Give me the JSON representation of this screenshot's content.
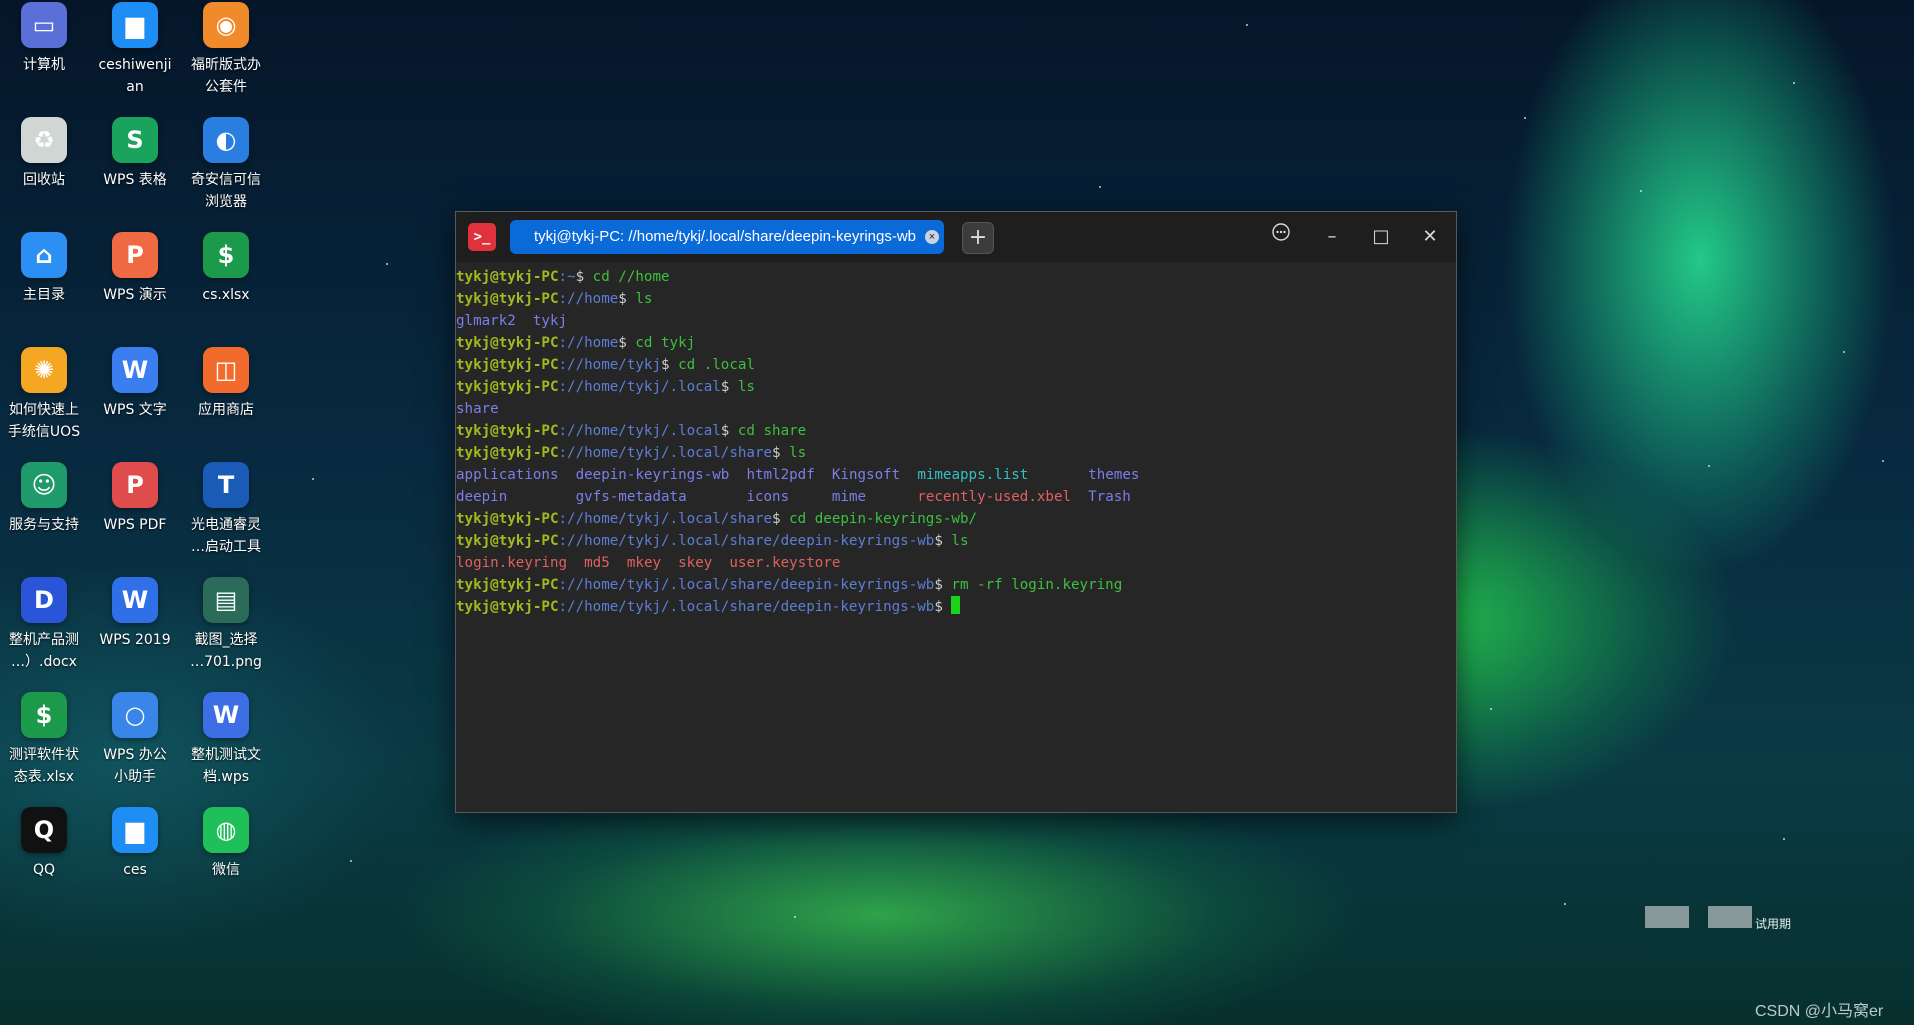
{
  "desktop": {
    "icons": [
      {
        "label": "计算机",
        "icon": "computer-icon",
        "color": "#5a6fd8"
      },
      {
        "label": "ceshiwenji\nan",
        "icon": "folder-icon",
        "color": "#1e8ef5"
      },
      {
        "label": "福昕版式办\n公套件",
        "icon": "ofd-icon",
        "color": "#f08a2a"
      },
      {
        "label": "回收站",
        "icon": "trash-icon",
        "color": "#cfd6d3"
      },
      {
        "label": "WPS 表格",
        "icon": "wps-spreadsheet-icon",
        "color": "#1aa35c"
      },
      {
        "label": "奇安信可信\n浏览器",
        "icon": "browser-icon",
        "color": "#2a7ee0"
      },
      {
        "label": "主目录",
        "icon": "home-folder-icon",
        "color": "#2c8ff3"
      },
      {
        "label": "WPS 演示",
        "icon": "wps-presentation-icon",
        "color": "#ef6a42"
      },
      {
        "label": "cs.xlsx",
        "icon": "xlsx-file-icon",
        "color": "#1c9a4c"
      },
      {
        "label": "如何快速上\n手统信UOS",
        "icon": "uos-guide-icon",
        "color": "#f5a623"
      },
      {
        "label": "WPS 文字",
        "icon": "wps-writer-icon",
        "color": "#3a7ef0"
      },
      {
        "label": "应用商店",
        "icon": "app-store-icon",
        "color": "#f26b2c"
      },
      {
        "label": "服务与支持",
        "icon": "support-icon",
        "color": "#1f9a6a"
      },
      {
        "label": "WPS PDF",
        "icon": "wps-pdf-icon",
        "color": "#e04b4b"
      },
      {
        "label": "光电通睿灵\n…启动工具",
        "icon": "toec-icon",
        "color": "#1a5bb8"
      },
      {
        "label": "整机产品测\n…）.docx",
        "icon": "docx-file-icon",
        "color": "#2a55d8"
      },
      {
        "label": "WPS 2019",
        "icon": "wps-2019-icon",
        "color": "#2f6fe8"
      },
      {
        "label": "截图_选择\n…701.png",
        "icon": "image-file-icon",
        "color": "#2a6b5a"
      },
      {
        "label": "测评软件状\n态表.xlsx",
        "icon": "xlsx-file-icon",
        "color": "#1c9a4c"
      },
      {
        "label": "WPS 办公\n小助手",
        "icon": "wps-assistant-icon",
        "color": "#3a86e8"
      },
      {
        "label": "整机测试文\n档.wps",
        "icon": "wps-doc-icon",
        "color": "#3d6ee6"
      },
      {
        "label": "QQ",
        "icon": "qq-icon",
        "color": "#111111"
      },
      {
        "label": "ces",
        "icon": "folder-icon",
        "color": "#1e8ef5"
      },
      {
        "label": "微信",
        "icon": "wechat-icon",
        "color": "#1fbf5a"
      }
    ]
  },
  "terminal": {
    "tab_title": "tykj@tykj-PC: //home/tykj/.local/share/deepin-keyrings-wb",
    "tab_close": "×",
    "new_tab": "+",
    "menu_label": "⋯",
    "minimize_label": "–",
    "maximize_label": "□",
    "close_label": "✕",
    "lines": [
      {
        "type": "prompt",
        "user": "tykj@tykj-PC",
        "path": "~",
        "cmd": " cd //home"
      },
      {
        "type": "prompt",
        "user": "tykj@tykj-PC",
        "path": "//home",
        "cmd": " ls"
      },
      {
        "type": "output",
        "items": [
          {
            "text": "glmark2",
            "cls": "c-dir"
          },
          {
            "text": "  ",
            "cls": ""
          },
          {
            "text": "tykj",
            "cls": "c-dir"
          }
        ]
      },
      {
        "type": "prompt",
        "user": "tykj@tykj-PC",
        "path": "//home",
        "cmd": " cd tykj"
      },
      {
        "type": "prompt",
        "user": "tykj@tykj-PC",
        "path": "//home/tykj",
        "cmd": " cd .local"
      },
      {
        "type": "prompt",
        "user": "tykj@tykj-PC",
        "path": "//home/tykj/.local",
        "cmd": " ls"
      },
      {
        "type": "output",
        "items": [
          {
            "text": "share",
            "cls": "c-dir"
          }
        ]
      },
      {
        "type": "prompt",
        "user": "tykj@tykj-PC",
        "path": "//home/tykj/.local",
        "cmd": " cd share"
      },
      {
        "type": "prompt",
        "user": "tykj@tykj-PC",
        "path": "//home/tykj/.local/share",
        "cmd": " ls"
      },
      {
        "type": "output",
        "items": [
          {
            "text": "applications",
            "cls": "c-dir"
          },
          {
            "text": "  ",
            "cls": ""
          },
          {
            "text": "deepin-keyrings-wb",
            "cls": "c-dir"
          },
          {
            "text": "  ",
            "cls": ""
          },
          {
            "text": "html2pdf",
            "cls": "c-dir"
          },
          {
            "text": "  ",
            "cls": ""
          },
          {
            "text": "Kingsoft",
            "cls": "c-dir"
          },
          {
            "text": "  ",
            "cls": ""
          },
          {
            "text": "mimeapps.list",
            "cls": "c-cyan"
          },
          {
            "text": "       ",
            "cls": ""
          },
          {
            "text": "themes",
            "cls": "c-dir"
          }
        ]
      },
      {
        "type": "output",
        "items": [
          {
            "text": "deepin",
            "cls": "c-dir"
          },
          {
            "text": "        ",
            "cls": ""
          },
          {
            "text": "gvfs-metadata",
            "cls": "c-dir"
          },
          {
            "text": "       ",
            "cls": ""
          },
          {
            "text": "icons",
            "cls": "c-dir"
          },
          {
            "text": "     ",
            "cls": ""
          },
          {
            "text": "mime",
            "cls": "c-dir"
          },
          {
            "text": "      ",
            "cls": ""
          },
          {
            "text": "recently-used.xbel",
            "cls": "c-red"
          },
          {
            "text": "  ",
            "cls": ""
          },
          {
            "text": "Trash",
            "cls": "c-dir"
          }
        ]
      },
      {
        "type": "prompt",
        "user": "tykj@tykj-PC",
        "path": "//home/tykj/.local/share",
        "cmd": " cd deepin-keyrings-wb/"
      },
      {
        "type": "prompt",
        "user": "tykj@tykj-PC",
        "path": "//home/tykj/.local/share/deepin-keyrings-wb",
        "cmd": " ls"
      },
      {
        "type": "output",
        "items": [
          {
            "text": "login.keyring",
            "cls": "c-red"
          },
          {
            "text": "  ",
            "cls": ""
          },
          {
            "text": "md5",
            "cls": "c-red"
          },
          {
            "text": "  ",
            "cls": ""
          },
          {
            "text": "mkey",
            "cls": "c-red"
          },
          {
            "text": "  ",
            "cls": ""
          },
          {
            "text": "skey",
            "cls": "c-red"
          },
          {
            "text": "  ",
            "cls": ""
          },
          {
            "text": "user.keystore",
            "cls": "c-red"
          }
        ]
      },
      {
        "type": "prompt",
        "user": "tykj@tykj-PC",
        "path": "//home/tykj/.local/share/deepin-keyrings-wb",
        "cmd": " rm -rf login.keyring"
      },
      {
        "type": "prompt",
        "user": "tykj@tykj-PC",
        "path": "//home/tykj/.local/share/deepin-keyrings-wb",
        "cmd": " ",
        "cursor": true
      }
    ]
  },
  "overlay": {
    "trial_label": "试用期",
    "watermark": "CSDN @小马窝er"
  },
  "colors": {
    "tab_active": "#0a6ad8",
    "prompt_user": "#a4b820",
    "prompt_path": "#5d7ed6",
    "command": "#3fbf3f",
    "cursor": "#19d219"
  }
}
